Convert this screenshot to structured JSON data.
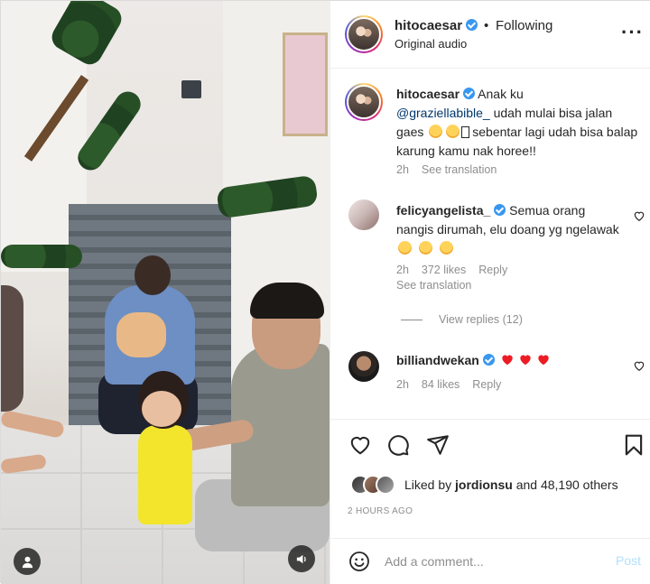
{
  "header": {
    "username": "hitocaesar",
    "separator": "•",
    "follow_status": "Following",
    "subtitle": "Original audio",
    "more_icon": "more-horizontal-icon"
  },
  "caption": {
    "username": "hitocaesar",
    "text_1": "Anak ku",
    "mention": "@graziellabible_",
    "text_2": "udah mulai bisa jalan gaes",
    "text_3": "sebentar lagi udah bisa balap karung kamu nak horee!!",
    "time": "2h",
    "see_translation": "See translation"
  },
  "comments": [
    {
      "username": "felicyangelista_",
      "text": "Semua orang nangis dirumah, elu doang yg ngelawak",
      "time": "2h",
      "likes": "372 likes",
      "reply": "Reply",
      "see_translation": "See translation",
      "view_replies": "View replies (12)"
    },
    {
      "username": "billiandwekan",
      "time": "2h",
      "likes": "84 likes",
      "reply": "Reply"
    }
  ],
  "actions": {
    "like_icon": "heart-icon",
    "comment_icon": "comment-icon",
    "share_icon": "share-icon",
    "save_icon": "bookmark-icon"
  },
  "likes": {
    "prefix": "Liked by",
    "user": "jordionsu",
    "suffix": "and 48,190 others"
  },
  "time_ago": "2 HOURS AGO",
  "add_comment": {
    "placeholder": "Add a comment...",
    "post_label": "Post"
  },
  "colors": {
    "link": "#00376b",
    "meta": "#8e8e8e",
    "verified": "#3897f0",
    "post_disabled": "#b2dffc",
    "heart": "#ed4956"
  }
}
